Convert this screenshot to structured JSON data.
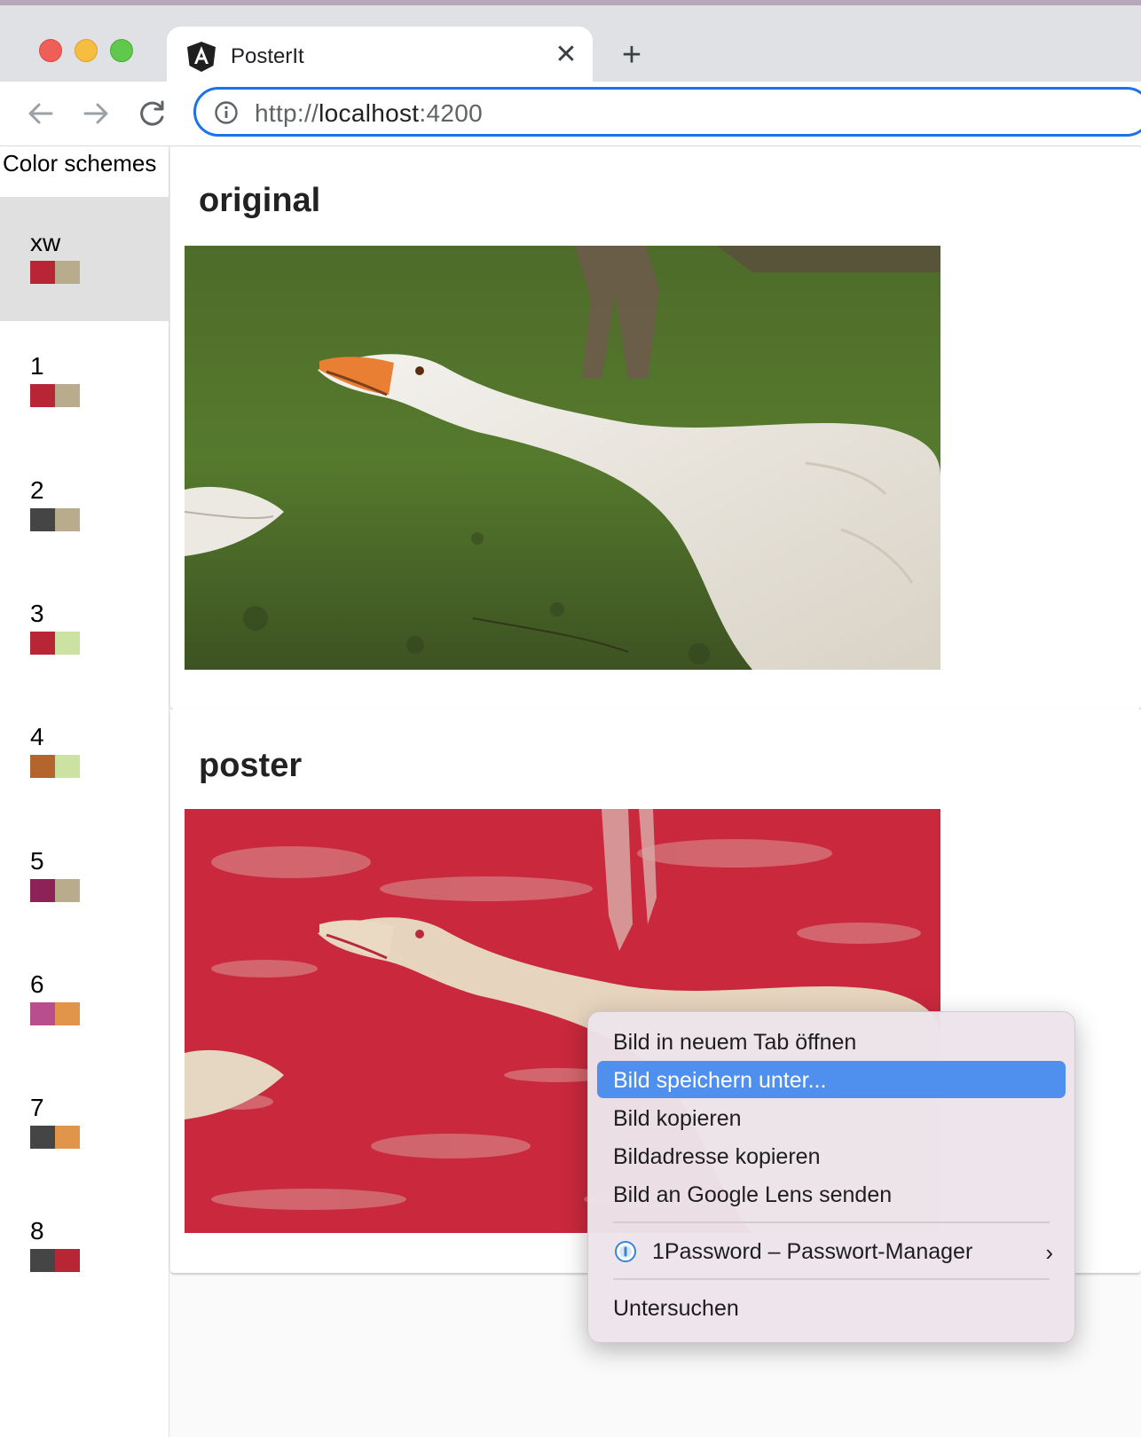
{
  "browser": {
    "tab_title": "PosterIt",
    "tab_close": "✕",
    "new_tab": "+",
    "url_scheme": "http://",
    "url_host": "localhost",
    "url_port": ":4200"
  },
  "sidebar": {
    "title": "Color schemes",
    "schemes": [
      {
        "label": "xw",
        "colors": [
          "#b82535",
          "#b9ac8c"
        ],
        "selected": true
      },
      {
        "label": "1",
        "colors": [
          "#b82535",
          "#b9ac8c"
        ]
      },
      {
        "label": "2",
        "colors": [
          "#454545",
          "#b9ac8c"
        ]
      },
      {
        "label": "3",
        "colors": [
          "#b82535",
          "#cbe2a3"
        ]
      },
      {
        "label": "4",
        "colors": [
          "#b3652b",
          "#cbe2a3"
        ]
      },
      {
        "label": "5",
        "colors": [
          "#8c2255",
          "#b9ac8c"
        ]
      },
      {
        "label": "6",
        "colors": [
          "#b84f8c",
          "#e0954a"
        ]
      },
      {
        "label": "7",
        "colors": [
          "#454545",
          "#e0954a"
        ]
      },
      {
        "label": "8",
        "colors": [
          "#454545",
          "#b82535"
        ]
      }
    ]
  },
  "main": {
    "original_title": "original",
    "poster_title": "poster"
  },
  "context_menu": {
    "items": [
      "Bild in neuem Tab öffnen",
      "Bild speichern unter...",
      "Bild kopieren",
      "Bildadresse kopieren",
      "Bild an Google Lens senden"
    ],
    "highlighted_index": 1,
    "extension_item": "1Password – Passwort-Manager",
    "extension_chevron": "›",
    "inspect": "Untersuchen"
  }
}
